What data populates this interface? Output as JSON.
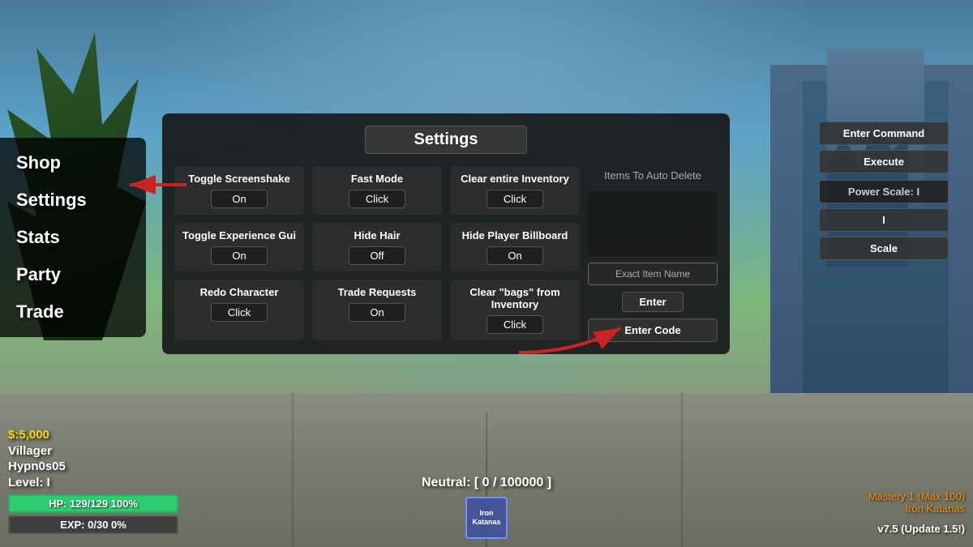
{
  "title": "Settings",
  "leftMenu": {
    "items": [
      {
        "label": "Shop",
        "active": false
      },
      {
        "label": "Settings",
        "active": true
      },
      {
        "label": "Stats",
        "active": false
      },
      {
        "label": "Party",
        "active": false
      },
      {
        "label": "Trade",
        "active": false
      }
    ]
  },
  "settings": {
    "title": "Settings",
    "row1": [
      {
        "label": "Toggle Screenshake",
        "value": "On"
      },
      {
        "label": "Fast Mode",
        "value": "Click"
      },
      {
        "label": "Clear entire Inventory",
        "value": "Click"
      }
    ],
    "row2": [
      {
        "label": "Toggle Experience Gui",
        "value": "On"
      },
      {
        "label": "Hide Hair",
        "value": "Off"
      },
      {
        "label": "Hide Player Billboard",
        "value": "On"
      }
    ],
    "row3": [
      {
        "label": "Redo Character",
        "value": "Click"
      },
      {
        "label": "Trade Requests",
        "value": "On"
      },
      {
        "label": "Clear \"bags\" from Inventory",
        "value": "Click"
      }
    ],
    "itemsToAutoDelete": "Items To Auto Delete",
    "exactItemName": "Exact Item Name",
    "enterBtn": "Enter",
    "enterCodeBtn": "Enter Code"
  },
  "commandPanel": {
    "enterCommand": "Enter Command",
    "execute": "Execute",
    "powerScale": "Power Scale: I",
    "scaleValue": "I",
    "scaleBtn": "Scale"
  },
  "hud": {
    "money": "$:5,000",
    "class": "Villager",
    "username": "Hypn0s05",
    "level": "Level: I",
    "hp": "HP: 129/129 100%",
    "exp": "EXP: 0/30 0%",
    "neutral": "Neutral: [ 0 / 100000 ]",
    "item": "Iron\nKatanas",
    "mastery": "Mastery 1 (Max 100)",
    "itemName": "Iron Katanas",
    "version": "v7.5 (Update 1.5!)"
  }
}
